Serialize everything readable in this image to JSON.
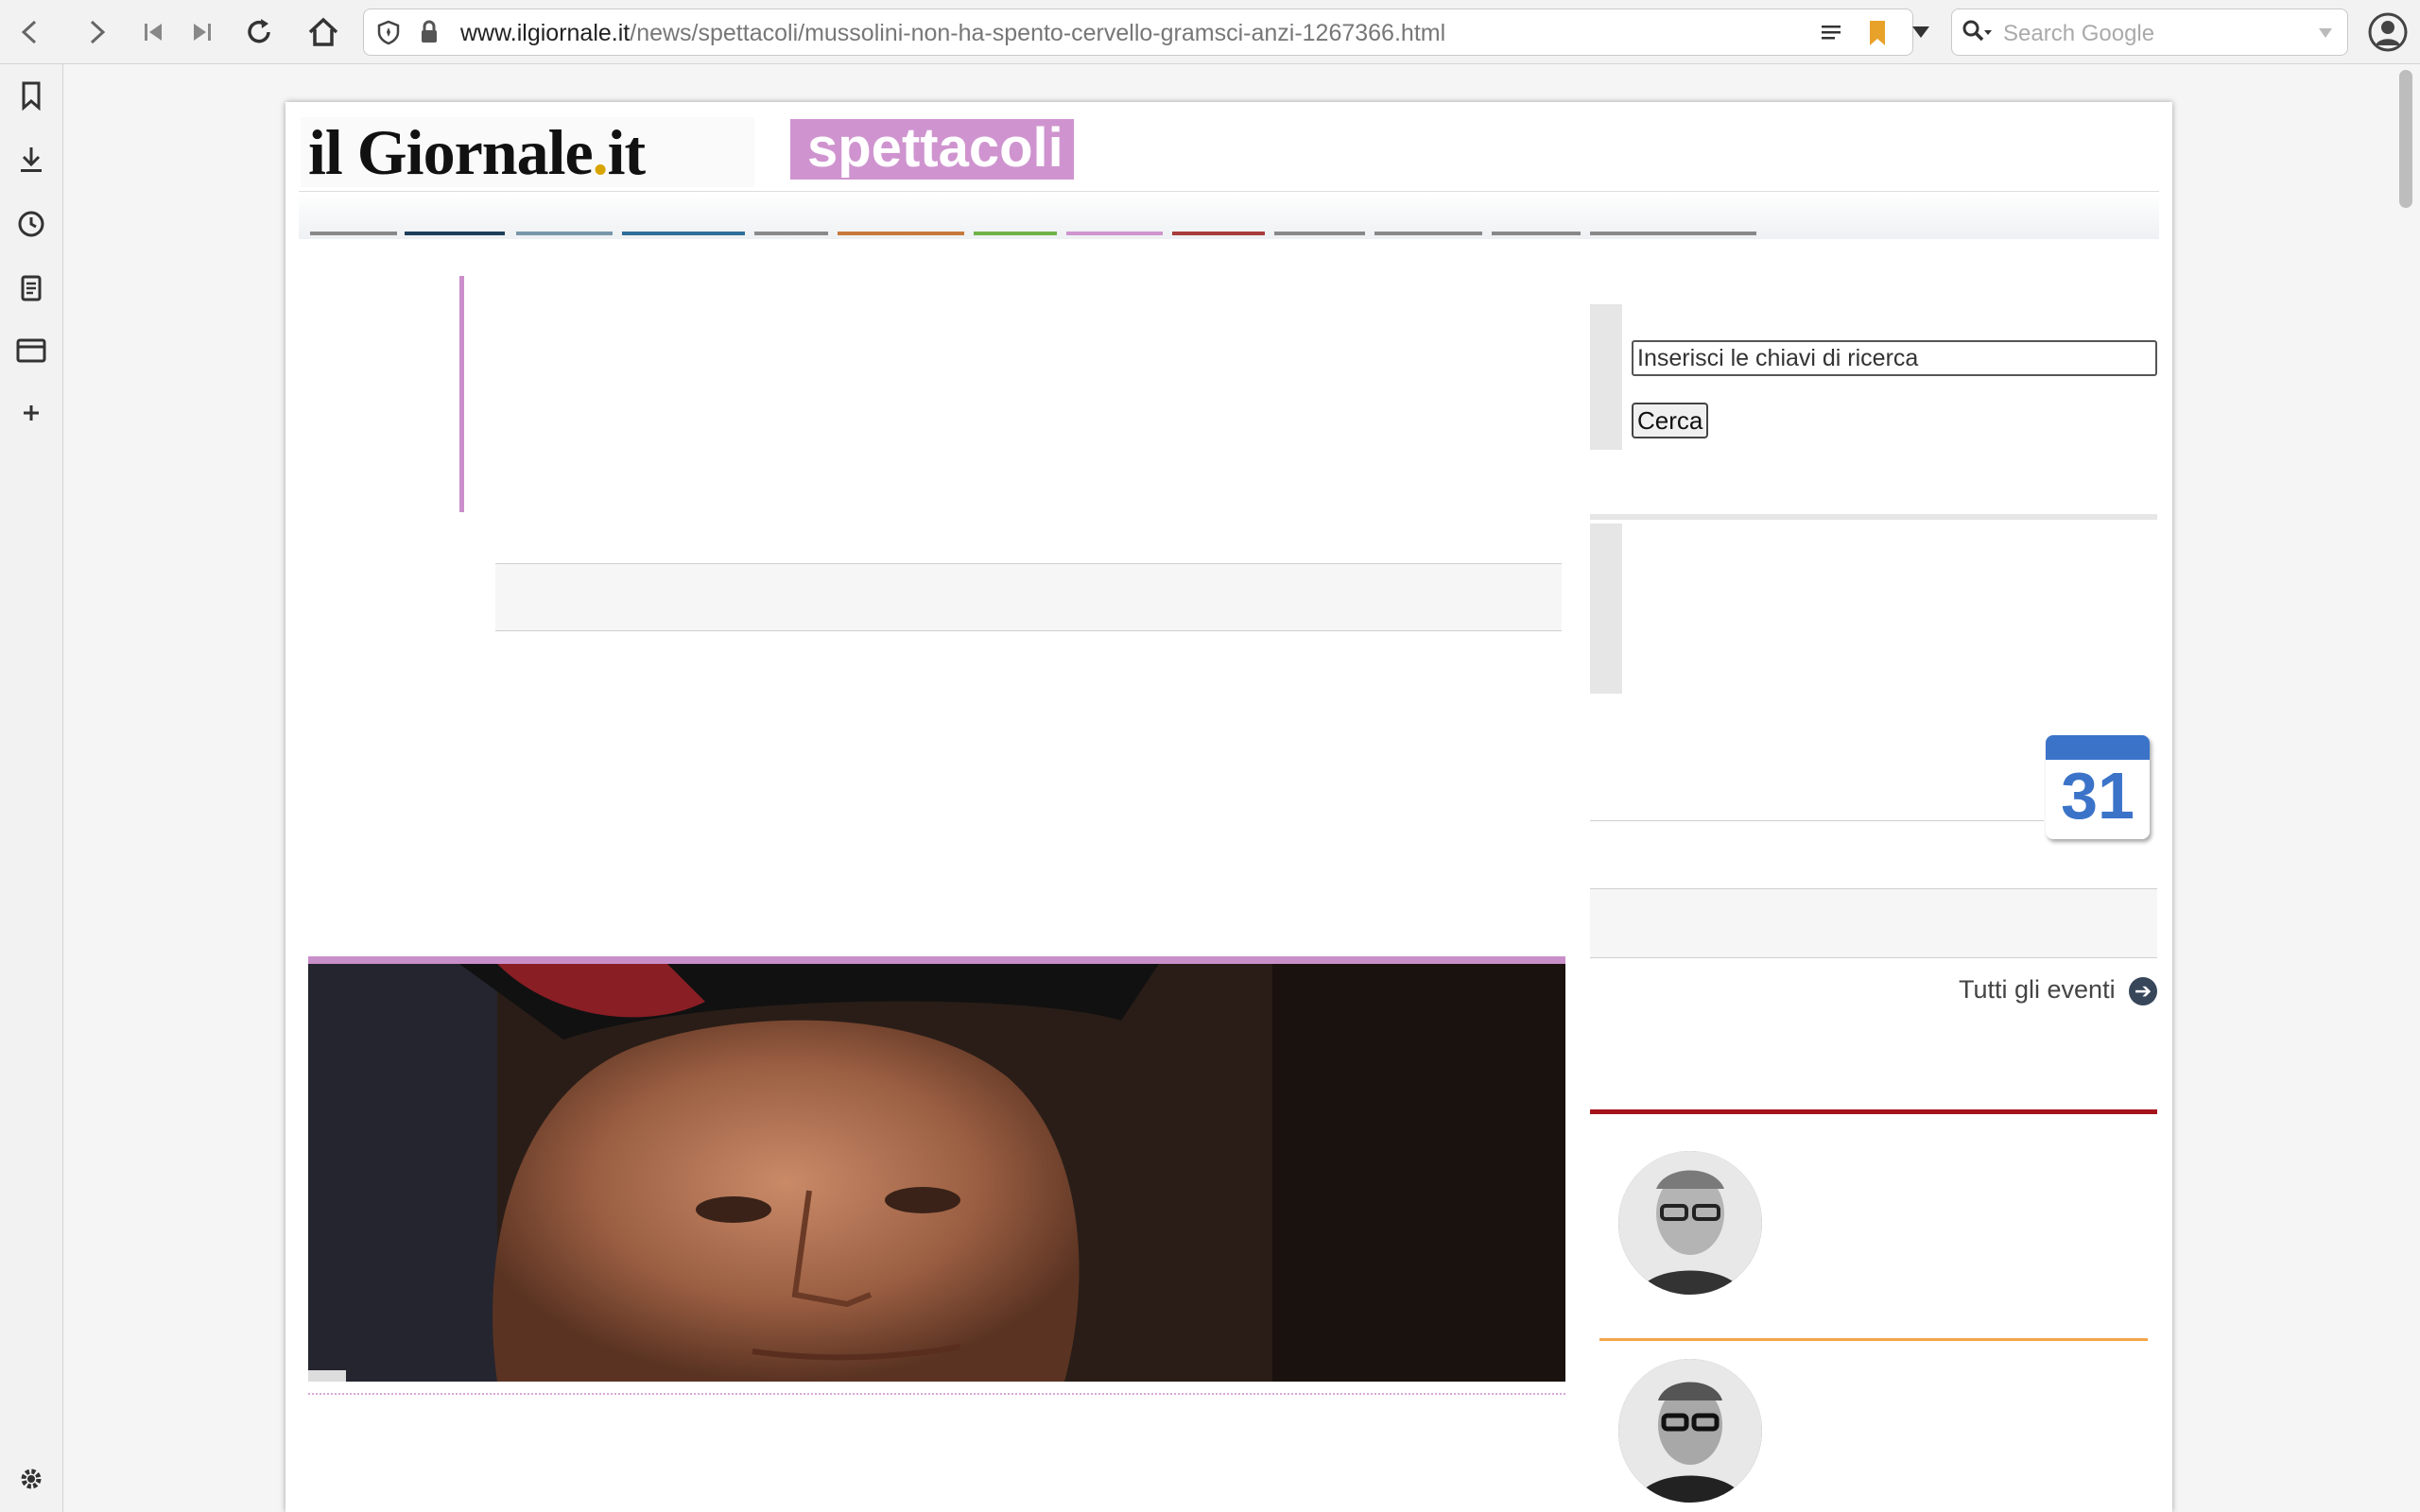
{
  "browser": {
    "url_domain": "www.ilgiornale.it",
    "url_path": "/news/spettacoli/mussolini-non-ha-spento-cervello-gramsci-anzi-1267366.html",
    "search_placeholder": "Search Google"
  },
  "site": {
    "logo_text_main": "il Giornale",
    "logo_dot": ".",
    "logo_text_tld": "it",
    "section": "spettacoli",
    "nav_colors": [
      "#888888",
      "#1e3f5a",
      "#7896aa",
      "#2e6e9a",
      "#8a8a8a",
      "#c87a3c",
      "#6fb24a",
      "#cf94cf",
      "#a83c3c",
      "#888888",
      "#888888",
      "#888888",
      "#888888"
    ]
  },
  "sidebar": {
    "search_placeholder": "Inserisci le chiavi di ricerca",
    "search_button": "Cerca",
    "calendar_day": "31",
    "all_events": "Tutti gli eventi",
    "arrow_icon": "➔"
  }
}
